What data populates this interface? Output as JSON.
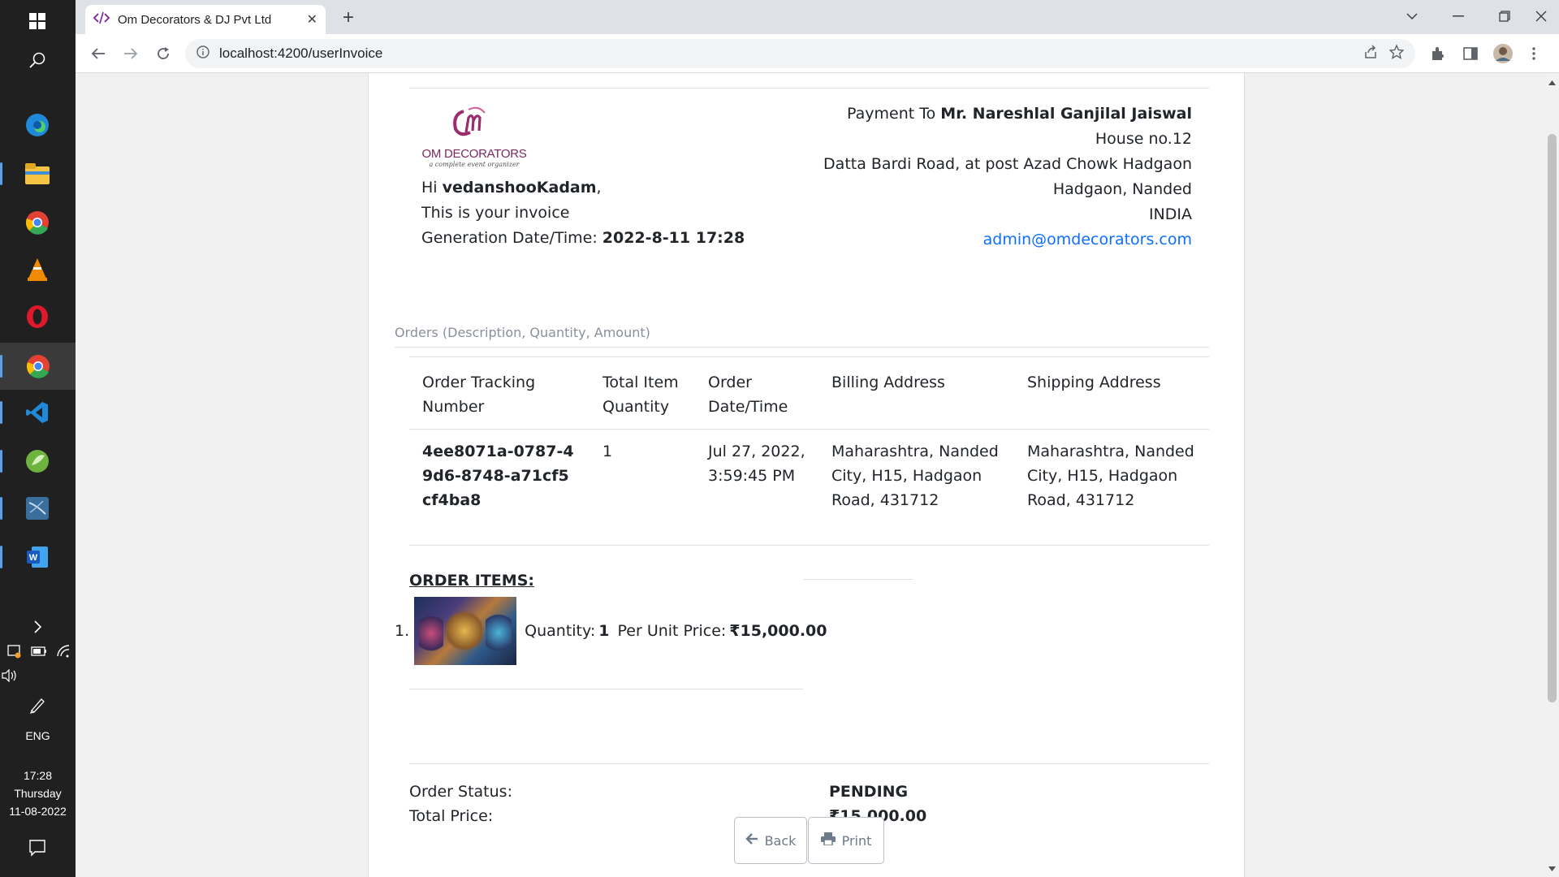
{
  "taskbar": {
    "time": "17:28",
    "day": "Thursday",
    "date": "11-08-2022",
    "language": "ENG"
  },
  "browser": {
    "tab_title": "Om Decorators & DJ Pvt Ltd",
    "url": "localhost:4200/userInvoice"
  },
  "logo": {
    "name": "OM DECORATORS",
    "tagline": "a complete event organizer"
  },
  "invoice": {
    "greeting_prefix": "Hi ",
    "user_name": "vedanshooKadam",
    "greeting_suffix": ",",
    "subtitle": "This is your invoice",
    "generation_label": "Generation Date/Time: ",
    "generation_value": "2022-8-11 17:28"
  },
  "payment": {
    "label": "Payment To ",
    "name": "Mr. Nareshlal Ganjilal Jaiswal",
    "address_lines": [
      "House no.12",
      "Datta Bardi Road, at post Azad Chowk Hadgaon",
      "Hadgaon, Nanded",
      "INDIA"
    ],
    "email": "admin@omdecorators.com"
  },
  "orders": {
    "caption": "Orders (Description, Quantity, Amount)",
    "headers": [
      "Order Tracking Number",
      "Total Item Quantity",
      "Order Date/Time",
      "Billing Address",
      "Shipping Address"
    ],
    "rows": [
      [
        "4ee8071a-0787-49d6-8748-a71cf5cf4ba8",
        "1",
        "Jul 27, 2022, 3:59:45 PM",
        "Maharashtra, Nanded City, H15, Hadgaon Road, 431712",
        "Maharashtra, Nanded City, H15, Hadgaon Road, 431712"
      ]
    ]
  },
  "order_items": {
    "heading": "ORDER ITEMS:",
    "items": [
      {
        "index": "1.",
        "quantity_label": "Quantity: ",
        "quantity": "1",
        "price_label": "Per Unit Price: ",
        "price": "₹15,000.00"
      }
    ]
  },
  "summary": {
    "status_label": "Order Status:",
    "status_value": "PENDING",
    "total_label": "Total Price:",
    "total_value": "₹15,000.00"
  },
  "buttons": {
    "back": "Back",
    "print": "Print"
  },
  "colors": {
    "link": "#0d6efd",
    "taskbar": "#202020",
    "logo_magenta": "#9b2c6f"
  }
}
